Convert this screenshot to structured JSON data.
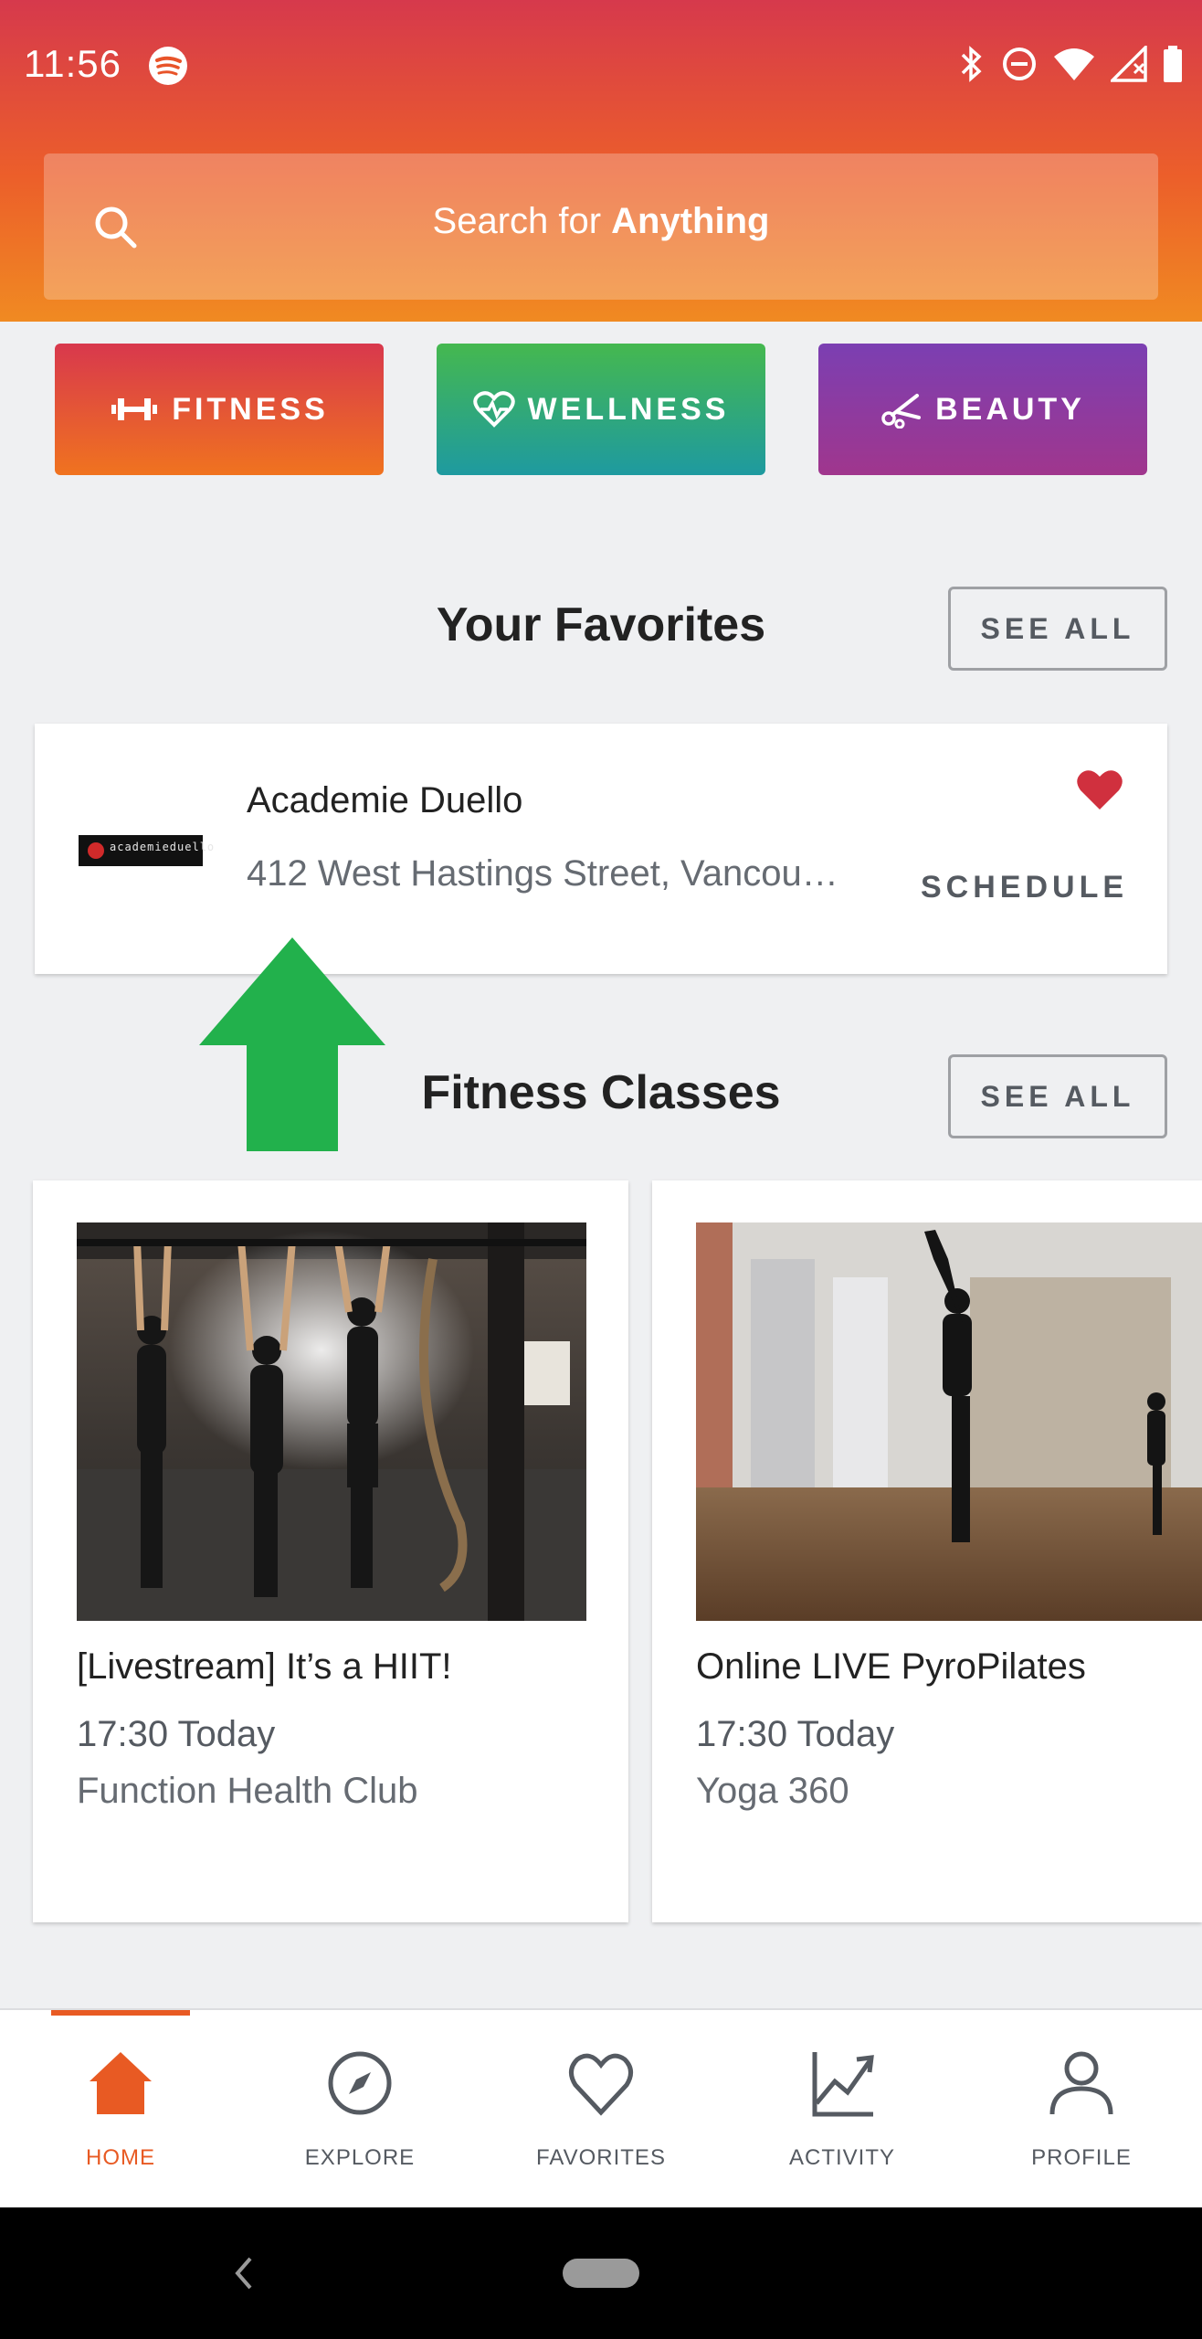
{
  "status_bar": {
    "time": "11:56",
    "icons": [
      "spotify-icon",
      "bluetooth-icon",
      "do-not-disturb-icon",
      "wifi-icon",
      "signal-icon",
      "battery-icon"
    ]
  },
  "search": {
    "prefix": "Search for ",
    "highlight": "Anything"
  },
  "categories": [
    {
      "label": "FITNESS",
      "icon": "dumbbell-icon"
    },
    {
      "label": "WELLNESS",
      "icon": "heart-pulse-icon"
    },
    {
      "label": "BEAUTY",
      "icon": "scissors-icon"
    }
  ],
  "favorites": {
    "title": "Your Favorites",
    "see_all": "SEE ALL",
    "items": [
      {
        "name": "Academie Duello",
        "address": "412 West Hastings Street, Vancou…",
        "action": "SCHEDULE",
        "logo_text": "academieduello"
      }
    ]
  },
  "fitness_classes": {
    "title": "Fitness Classes",
    "see_all": "SEE ALL",
    "items": [
      {
        "title": "[Livestream] It’s a HIIT!",
        "time": "17:30 Today",
        "venue": "Function Health Club"
      },
      {
        "title": "Online LIVE PyroPilates",
        "time": "17:30 Today",
        "venue": "Yoga 360"
      }
    ]
  },
  "bottom_nav": {
    "items": [
      {
        "label": "HOME",
        "icon": "home-icon",
        "active": true
      },
      {
        "label": "EXPLORE",
        "icon": "compass-icon",
        "active": false
      },
      {
        "label": "FAVORITES",
        "icon": "heart-icon",
        "active": false
      },
      {
        "label": "ACTIVITY",
        "icon": "activity-chart-icon",
        "active": false
      },
      {
        "label": "PROFILE",
        "icon": "profile-icon",
        "active": false
      }
    ]
  },
  "colors": {
    "accent": "#e85a23",
    "favorite_heart": "#d0303e",
    "annotation_arrow": "#22b14c"
  }
}
